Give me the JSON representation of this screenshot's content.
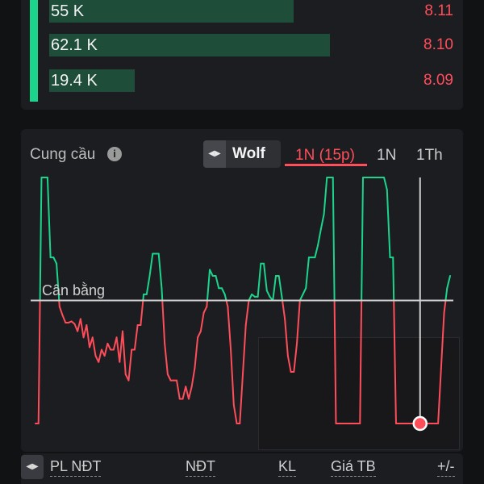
{
  "order_book": {
    "rows": [
      {
        "volume": "55 K",
        "price": "8.11",
        "fill": 0.6
      },
      {
        "volume": "62.1 K",
        "price": "8.10",
        "fill": 0.69
      },
      {
        "volume": "19.4 K",
        "price": "8.09",
        "fill": 0.21
      }
    ]
  },
  "panel": {
    "title": "Cung cầu",
    "info_icon": "info-icon",
    "source_selector": "Wolf",
    "timeframes": [
      {
        "label": "1N (15p)",
        "active": true
      },
      {
        "label": "1N",
        "active": false
      },
      {
        "label": "1Th",
        "active": false
      }
    ]
  },
  "chart_data": {
    "type": "area",
    "baseline_label": "Cân bằng",
    "colors": {
      "above": "#1bd58d",
      "below": "#ff4d5a",
      "baseline": "#cfcfcf",
      "cursor": "#cfcfcf"
    },
    "ylim": [
      -1,
      1
    ],
    "grid": false,
    "values": [
      -1,
      -1,
      1,
      1,
      1,
      0.35,
      0.35,
      0.3,
      -0.05,
      -0.12,
      -0.18,
      -0.18,
      -0.17,
      -0.19,
      -0.25,
      -0.15,
      -0.3,
      -0.2,
      -0.38,
      -0.3,
      -0.45,
      -0.5,
      -0.4,
      -0.45,
      -0.35,
      -0.4,
      -0.4,
      -0.3,
      -0.5,
      -0.25,
      -0.6,
      -0.65,
      -0.4,
      -0.4,
      -0.2,
      -0.2,
      0.05,
      0.05,
      0.2,
      0.38,
      0.38,
      0.38,
      0.1,
      -0.35,
      -0.6,
      -0.65,
      -0.65,
      -0.65,
      -0.8,
      -0.8,
      -0.7,
      -0.8,
      -0.7,
      -0.55,
      -0.3,
      -0.25,
      -0.1,
      -0.05,
      0.25,
      0.2,
      0.2,
      0.1,
      0.1,
      0.05,
      -0.05,
      -0.4,
      -0.85,
      -1,
      -1,
      -0.6,
      -0.2,
      0,
      0.05,
      0.03,
      0.03,
      0.3,
      0.3,
      0.08,
      0.03,
      0,
      0.2,
      0.2,
      0.03,
      -0.15,
      -0.45,
      -0.58,
      -0.58,
      -0.35,
      0,
      0.05,
      0.1,
      0.35,
      0.35,
      0.35,
      0.45,
      0.58,
      0.7,
      1,
      1,
      1,
      -1,
      -1,
      -1,
      -1,
      -1,
      -1,
      -1,
      -1,
      -1,
      1,
      1,
      1,
      1,
      1,
      1,
      1,
      1,
      0.9,
      0.35,
      0.35,
      -1,
      -1,
      -1,
      -1,
      -1,
      -1,
      -1,
      -1,
      -1,
      -1,
      -1,
      -1,
      -1,
      -1,
      -1,
      -0.55,
      -0.1,
      0.1,
      0.2
    ],
    "cursor_index": 128
  },
  "table_header": {
    "arrows_icon": "swap-arrows-icon",
    "columns": [
      "PL NĐT",
      "NĐT",
      "KL",
      "Giá TB",
      "+/-"
    ]
  }
}
